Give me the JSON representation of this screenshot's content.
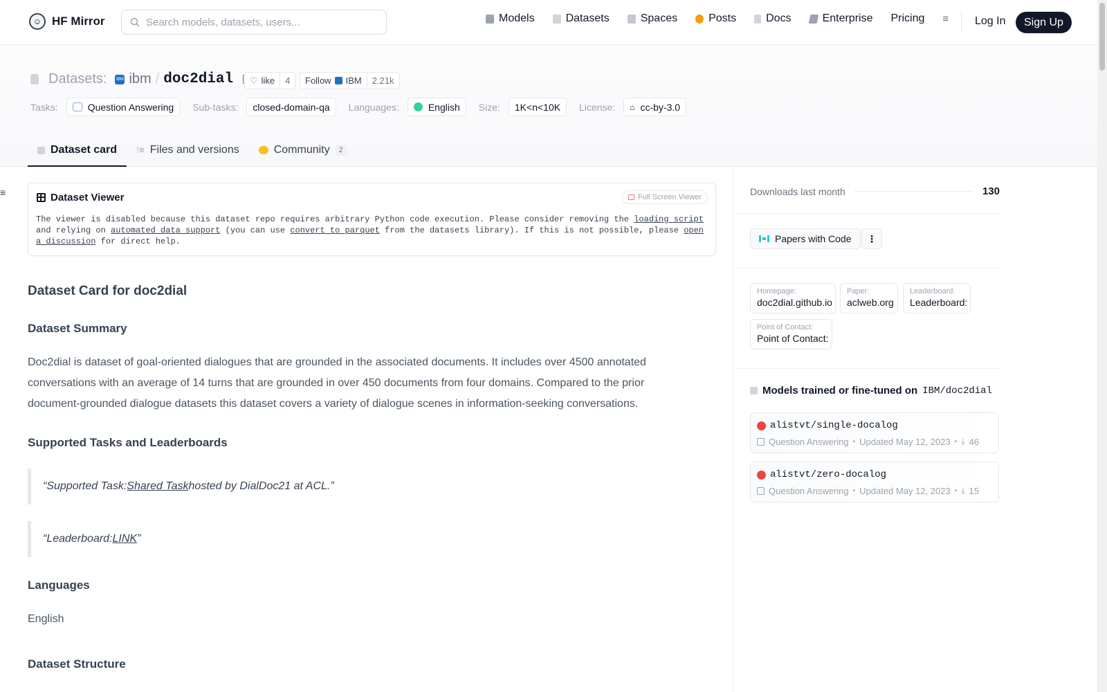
{
  "navbar": {
    "brand": "HF Mirror",
    "search_placeholder": "Search models, datasets, users...",
    "links": [
      {
        "label": "Models",
        "icon": "cube-icon",
        "color": "#9ca3af"
      },
      {
        "label": "Datasets",
        "icon": "database-icon",
        "color": "#d1d5db"
      },
      {
        "label": "Spaces",
        "icon": "spaces-icon",
        "color": "#c4c8d0"
      },
      {
        "label": "Posts",
        "icon": "posts-icon",
        "color": "#f59e0b"
      },
      {
        "label": "Docs",
        "icon": "docs-icon",
        "color": "#d1d5db"
      },
      {
        "label": "Enterprise",
        "icon": "enterprise-icon",
        "color": "#9ca3af"
      },
      {
        "label": "Pricing"
      }
    ],
    "login": "Log In",
    "signup": "Sign Up"
  },
  "header": {
    "label": "Datasets:",
    "org": "ibm",
    "org_badge": "IBM",
    "repo": "doc2dial",
    "like_label": "like",
    "like_count": "4",
    "follow_label": "Follow",
    "follow_org": "IBM",
    "follow_count": "2.21k",
    "tags": {
      "tasks_label": "Tasks:",
      "task": "Question Answering",
      "subtasks_label": "Sub-tasks:",
      "subtask": "closed-domain-qa",
      "languages_label": "Languages:",
      "language": "English",
      "size_label": "Size:",
      "size": "1K<n<10K",
      "license_label": "License:",
      "license": "cc-by-3.0"
    },
    "tabs": [
      {
        "label": "Dataset card",
        "active": true
      },
      {
        "label": "Files and versions"
      },
      {
        "label": "Community",
        "count": "2"
      }
    ]
  },
  "viewer": {
    "title": "Dataset Viewer",
    "fullscreen": "Full Screen Viewer",
    "msg_1": "The viewer is disabled because this dataset repo requires arbitrary Python code execution. Please consider removing the ",
    "link_1": "loading script",
    "msg_2": " and relying on ",
    "link_2": "automated data support",
    "msg_3": " (you can use ",
    "link_3": "convert to parquet",
    "msg_4": " from the datasets library). If this is not possible, please ",
    "link_4": "open a discussion",
    "msg_5": " for direct help."
  },
  "card": {
    "title": "Dataset Card for doc2dial",
    "summary_heading": "Dataset Summary",
    "summary": "Doc2dial is dataset of goal-oriented dialogues that are grounded in the associated documents. It includes over 4500 annotated conversations with an average of 14 turns that are grounded in over 450 documents from four domains. Compared to the prior document-grounded dialogue datasets this dataset covers a variety of dialogue scenes in information-seeking conversations.",
    "tasks_heading": "Supported Tasks and Leaderboards",
    "quote1_pre": "“Supported Task: ",
    "quote1_link": "Shared Task",
    "quote1_post": " hosted by DialDoc21 at ACL.”",
    "quote2_pre": "“Leaderboard: ",
    "quote2_link": "LINK",
    "quote2_post": "”",
    "languages_heading": "Languages",
    "languages": "English",
    "structure_heading": "Dataset Structure"
  },
  "sidebar": {
    "downloads_label": "Downloads last month",
    "downloads": "130",
    "pwc": "Papers with Code",
    "kebab": "⋮",
    "meta": [
      {
        "k": "Homepage:",
        "v": "doc2dial.github.io"
      },
      {
        "k": "Paper:",
        "v": "aclweb.org"
      },
      {
        "k": "Leaderboard:",
        "v": "Leaderboard:"
      },
      {
        "k": "Point of Contact:",
        "v": "Point of Contact:"
      }
    ],
    "models_heading": "Models trained or fine-tuned on",
    "models_repo": "IBM/doc2dial",
    "models": [
      {
        "name": "alistvt/single-docalog",
        "task": "Question Answering",
        "updated": "Updated May 12, 2023",
        "downloads": "46"
      },
      {
        "name": "alistvt/zero-docalog",
        "task": "Question Answering",
        "updated": "Updated May 12, 2023",
        "downloads": "15"
      }
    ]
  }
}
